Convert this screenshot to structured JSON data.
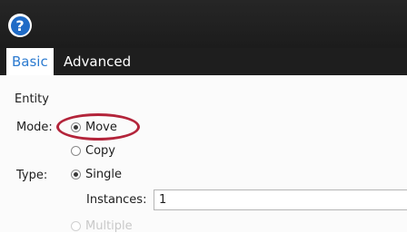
{
  "header": {
    "help_icon": "question-circle-icon",
    "help_symbol": "?"
  },
  "tabs": [
    {
      "label": "Basic",
      "active": true
    },
    {
      "label": "Advanced",
      "active": false
    }
  ],
  "form": {
    "section_label": "Entity",
    "mode": {
      "label": "Mode:",
      "options": [
        "Move",
        "Copy"
      ],
      "selected": "Move"
    },
    "type": {
      "label": "Type:",
      "options": [
        "Single",
        "Multiple"
      ],
      "selected": "Single"
    },
    "instances": {
      "label": "Instances:",
      "value": "1"
    }
  },
  "colors": {
    "header_bg": "#1f1f1f",
    "tab_active_text": "#2c7bd0",
    "highlight": "#b3243a",
    "help_icon": "#1f6bc6"
  }
}
